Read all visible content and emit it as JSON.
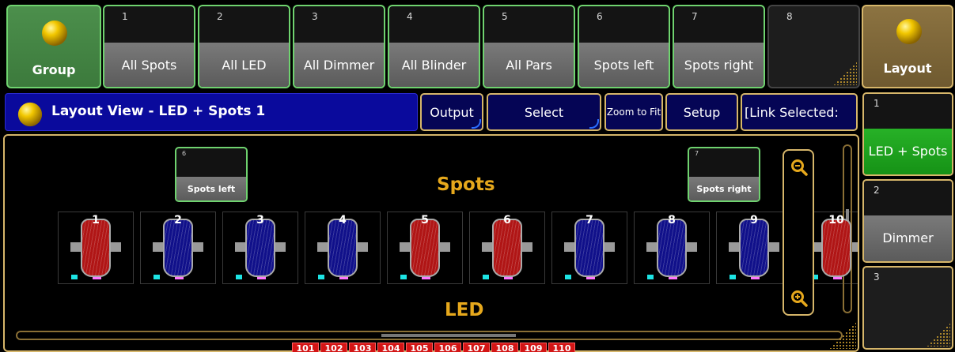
{
  "pool_bar": {
    "group_label": "Group",
    "groups": [
      {
        "number": "1",
        "name": "All Spots"
      },
      {
        "number": "2",
        "name": "All LED"
      },
      {
        "number": "3",
        "name": "All Dimmer"
      },
      {
        "number": "4",
        "name": "All Blinder"
      },
      {
        "number": "5",
        "name": "All Pars"
      },
      {
        "number": "6",
        "name": "Spots left"
      },
      {
        "number": "7",
        "name": "Spots right"
      },
      {
        "number": "8",
        "name": ""
      }
    ],
    "layout_label": "Layout"
  },
  "title_bar": {
    "title": "Layout View - LED + Spots 1",
    "buttons": {
      "output": "Output",
      "select": "Select",
      "zoom_to_fit": "Zoom to Fit",
      "setup": "Setup",
      "link_selected": "[Link Selected:"
    }
  },
  "layout_pool": [
    {
      "number": "1",
      "name": "LED + Spots",
      "active": true
    },
    {
      "number": "2",
      "name": "Dimmer",
      "active": false
    },
    {
      "number": "3",
      "name": "",
      "active": false
    }
  ],
  "view": {
    "macro_left": {
      "number": "6",
      "name": "Spots left"
    },
    "macro_right": {
      "number": "7",
      "name": "Spots right"
    },
    "spots_label": "Spots",
    "led_label": "LED",
    "fixtures": [
      {
        "id": "1",
        "color": "red"
      },
      {
        "id": "2",
        "color": "blue"
      },
      {
        "id": "3",
        "color": "blue"
      },
      {
        "id": "4",
        "color": "blue"
      },
      {
        "id": "5",
        "color": "red"
      },
      {
        "id": "6",
        "color": "red"
      },
      {
        "id": "7",
        "color": "blue"
      },
      {
        "id": "8",
        "color": "blue"
      },
      {
        "id": "9",
        "color": "blue"
      },
      {
        "id": "10",
        "color": "red"
      }
    ],
    "led_fixtures": [
      "101",
      "102",
      "103",
      "104",
      "105",
      "106",
      "107",
      "108",
      "109",
      "110"
    ],
    "zoom_in_icon": "zoom-in-icon",
    "zoom_out_icon": "zoom-out-icon"
  },
  "colors": {
    "group_green": "#3c7a3c",
    "pool_border": "#6fd36f",
    "title_blue": "#0a0a9c",
    "accent_gold": "#d6b66a",
    "label_orange": "#e6a81c",
    "fixture_red": "#b01515",
    "fixture_blue": "#10108a",
    "active_green": "#169216"
  }
}
